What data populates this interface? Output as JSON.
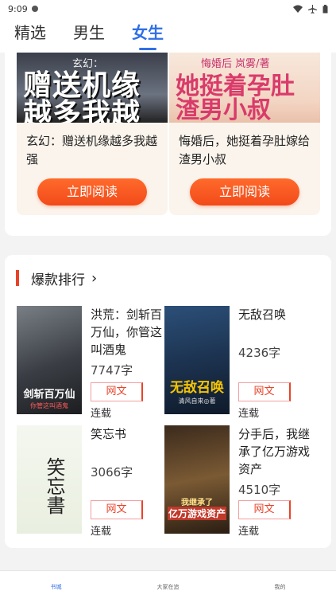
{
  "status": {
    "time": "9:09"
  },
  "tabs": [
    {
      "label": "精选"
    },
    {
      "label": "男生"
    },
    {
      "label": "女生"
    }
  ],
  "featured": [
    {
      "cover_text": "赠送机缘越多我越强",
      "cover_small": "玄幻：",
      "title": "玄幻：赠送机缘越多我越强",
      "button": "立即阅读"
    },
    {
      "cover_text": "她挺着孕肚渣男小叔",
      "cover_small": "悔婚后   岚雾/著",
      "title": "悔婚后，她挺着孕肚嫁给渣男小叔",
      "button": "立即阅读"
    }
  ],
  "ranking": {
    "title": "爆款排行",
    "books": [
      {
        "title": "洪荒：剑斩百万仙，你管这叫酒鬼",
        "count": "7747字",
        "tag": "网文",
        "status": "连载",
        "cover_text": "剑斩百万仙",
        "cover_sub": "你管这叫酒鬼"
      },
      {
        "title": "无敌召唤",
        "count": "4236字",
        "tag": "网文",
        "status": "连载",
        "cover_text": "无敌召唤",
        "cover_sub": "清风自来◎著"
      },
      {
        "title": "笑忘书",
        "count": "3066字",
        "tag": "网文",
        "status": "连载",
        "cover_text": "笑忘書",
        "cover_sub": ""
      },
      {
        "title": "分手后，我继承了亿万游戏资产",
        "count": "4510字",
        "tag": "网文",
        "status": "连载",
        "cover_text": "亿万游戏资产",
        "cover_sub": "我继承了"
      }
    ]
  },
  "bottom_nav": [
    {
      "label": "书城"
    },
    {
      "label": "大家在追"
    },
    {
      "label": "我的"
    }
  ],
  "colors": {
    "accent": "#2f6fe6",
    "button": "#f24a1a",
    "rank_bar": "#e8432a"
  }
}
